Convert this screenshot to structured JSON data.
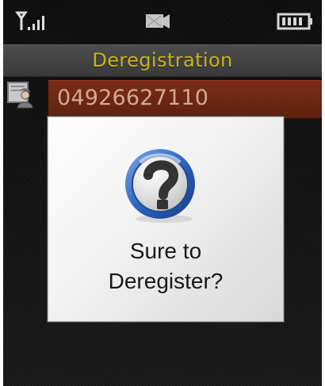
{
  "status_bar": {
    "signal_icon": "signal-strength-icon",
    "media_icon": "video-or-media-icon",
    "battery_icon": "battery-icon"
  },
  "screen": {
    "title": "Deregistration",
    "selected_item": {
      "icon": "contact-card-icon",
      "number": "04926627110"
    }
  },
  "dialog": {
    "icon": "question-mark-icon",
    "message_line_1": "Sure to",
    "message_line_2": "Deregister?"
  },
  "colors": {
    "title_text": "#c7b41e",
    "selected_background": "#6b2814",
    "selected_text": "#d7a891",
    "dialog_background": "#f2f2f2",
    "question_blue": "#2d63bd"
  }
}
